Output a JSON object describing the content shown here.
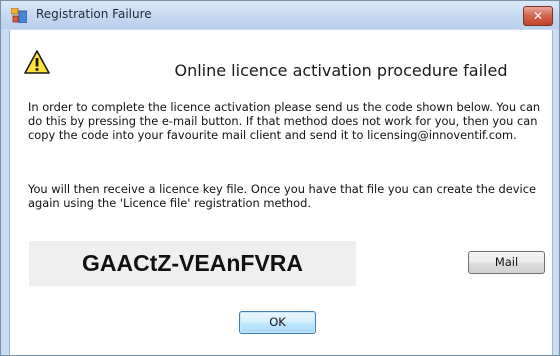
{
  "window": {
    "title": "Registration Failure",
    "close_label": "✕"
  },
  "dialog": {
    "heading": "Online licence activation procedure failed",
    "paragraph1": "In order to complete the licence activation please send us the code shown below. You can do this by pressing the e-mail button. If that method does not work for you, then you can copy the code into your favourite mail client and send it to licensing@innoventif.com.",
    "paragraph2": "You will then receive a licence key file. Once you have that file you can create the device again using the 'Licence file' registration method.",
    "code": "GAACtZ-VEAnFVRA",
    "mail_label": "Mail",
    "ok_label": "OK"
  },
  "icons": {
    "app": "app-icon",
    "warning": "warning-icon"
  },
  "colors": {
    "titlebar": "#c5d8f1",
    "close_button": "#c2442c",
    "code_background": "#efefef",
    "ok_button_border": "#3c7fb1"
  }
}
